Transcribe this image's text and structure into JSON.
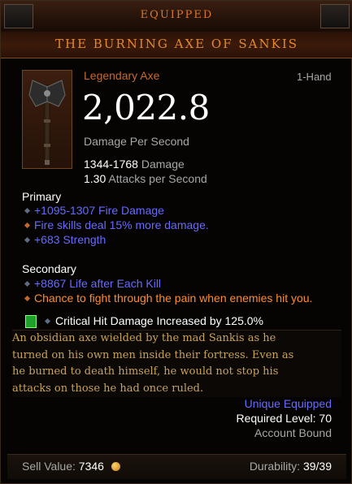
{
  "header": {
    "title": "EQUIPPED",
    "item_name": "THE BURNING AXE OF SANKIS"
  },
  "item": {
    "type": "Legendary Axe",
    "slot": "1-Hand",
    "dps": "2,022.8",
    "dps_label": "Damage Per Second",
    "damage_range": "1344-1768",
    "damage_label": "Damage",
    "aps": "1.30",
    "aps_label": "Attacks per Second"
  },
  "primary": {
    "heading": "Primary",
    "affixes": [
      "+1095-1307 Fire Damage",
      "Fire skills deal 15% more damage.",
      "+683 Strength"
    ]
  },
  "secondary": {
    "heading": "Secondary",
    "affixes": [
      "+8867 Life after Each Kill",
      "Chance to fight through the pain when enemies hit you."
    ]
  },
  "socket": {
    "text": "Critical Hit Damage Increased by 125.0%",
    "icon": "emerald-gem-icon"
  },
  "flavor": [
    "An obsidian axe wielded by the mad Sankis as he",
    "turned on his own men inside their fortress. Even as",
    "he burned to death himself, he would not stop his",
    "attacks on those he had once ruled."
  ],
  "status": {
    "equipped": "Unique Equipped",
    "required_level": "Required Level: 70",
    "bound": "Account Bound"
  },
  "footer": {
    "sell_label": "Sell Value:",
    "sell_value": "7346",
    "durability_label": "Durability:",
    "durability_value": "39/39"
  },
  "colors": {
    "legendary": "#c7692a",
    "magic": "#6969ff",
    "flavor": "#c8a35a"
  }
}
